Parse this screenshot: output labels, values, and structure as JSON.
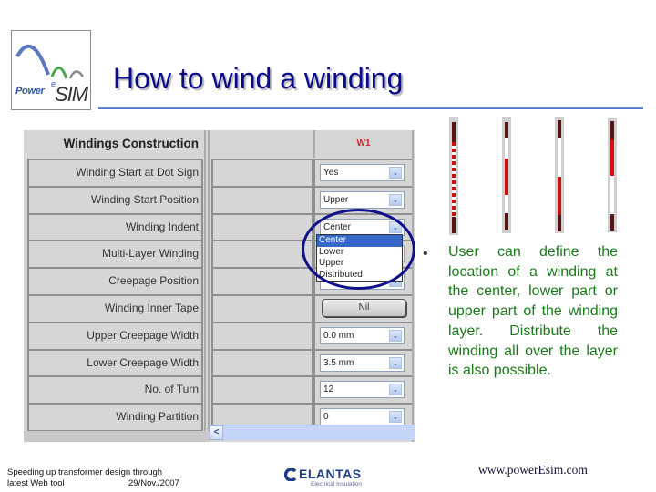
{
  "logo": {
    "text_power": "Power",
    "text_e": "e",
    "text_sim": "SIM"
  },
  "title": "How to wind a winding",
  "panel": {
    "section_header": "Windings Construction",
    "column_header": "W1",
    "rows": [
      {
        "label": "Winding Start at Dot Sign",
        "type": "select",
        "value": "Yes"
      },
      {
        "label": "Winding Start Position",
        "type": "select",
        "value": "Upper"
      },
      {
        "label": "Winding Indent",
        "type": "select",
        "value": "Center"
      },
      {
        "label": "Multi-Layer Winding",
        "type": "select",
        "value": ""
      },
      {
        "label": "Creepage Position",
        "type": "select",
        "value": ""
      },
      {
        "label": "Winding Inner Tape",
        "type": "button",
        "value": "Nil"
      },
      {
        "label": "Upper Creepage Width",
        "type": "select",
        "value": "0.0 mm"
      },
      {
        "label": "Lower Creepage Width",
        "type": "select",
        "value": "3.5 mm"
      },
      {
        "label": "No. of Turn",
        "type": "select",
        "value": "12"
      },
      {
        "label": "Winding Partition",
        "type": "select",
        "value": "0"
      }
    ],
    "dropdown": {
      "options": [
        "Center",
        "Lower",
        "Upper",
        "Distributed"
      ],
      "selected": "Center"
    },
    "arrow_glyph": "⌄",
    "scroll_left_glyph": "<"
  },
  "diagrams": [
    {
      "name": "distributed"
    },
    {
      "name": "center"
    },
    {
      "name": "lower"
    },
    {
      "name": "upper"
    }
  ],
  "bullet": {
    "dot": "•",
    "text": "User can define the location of a winding at the center, lower part or upper part of the winding layer. Distribute the winding all over the layer is also possible."
  },
  "footer": {
    "line1": "Speeding up transformer design through",
    "line2": "latest Web tool",
    "date": "29/Nov./2007",
    "brand": "ELANTAS",
    "brand_sub": "Electrical Insulation",
    "url": "www.powerEsim.com"
  },
  "colors": {
    "title": "#0a0a8c",
    "bullet_text": "#1a7a1a",
    "highlight_ellipse": "#10108c",
    "column_header": "#dd2222",
    "winding_red": "#d01010",
    "winding_dark": "#5a1414"
  }
}
